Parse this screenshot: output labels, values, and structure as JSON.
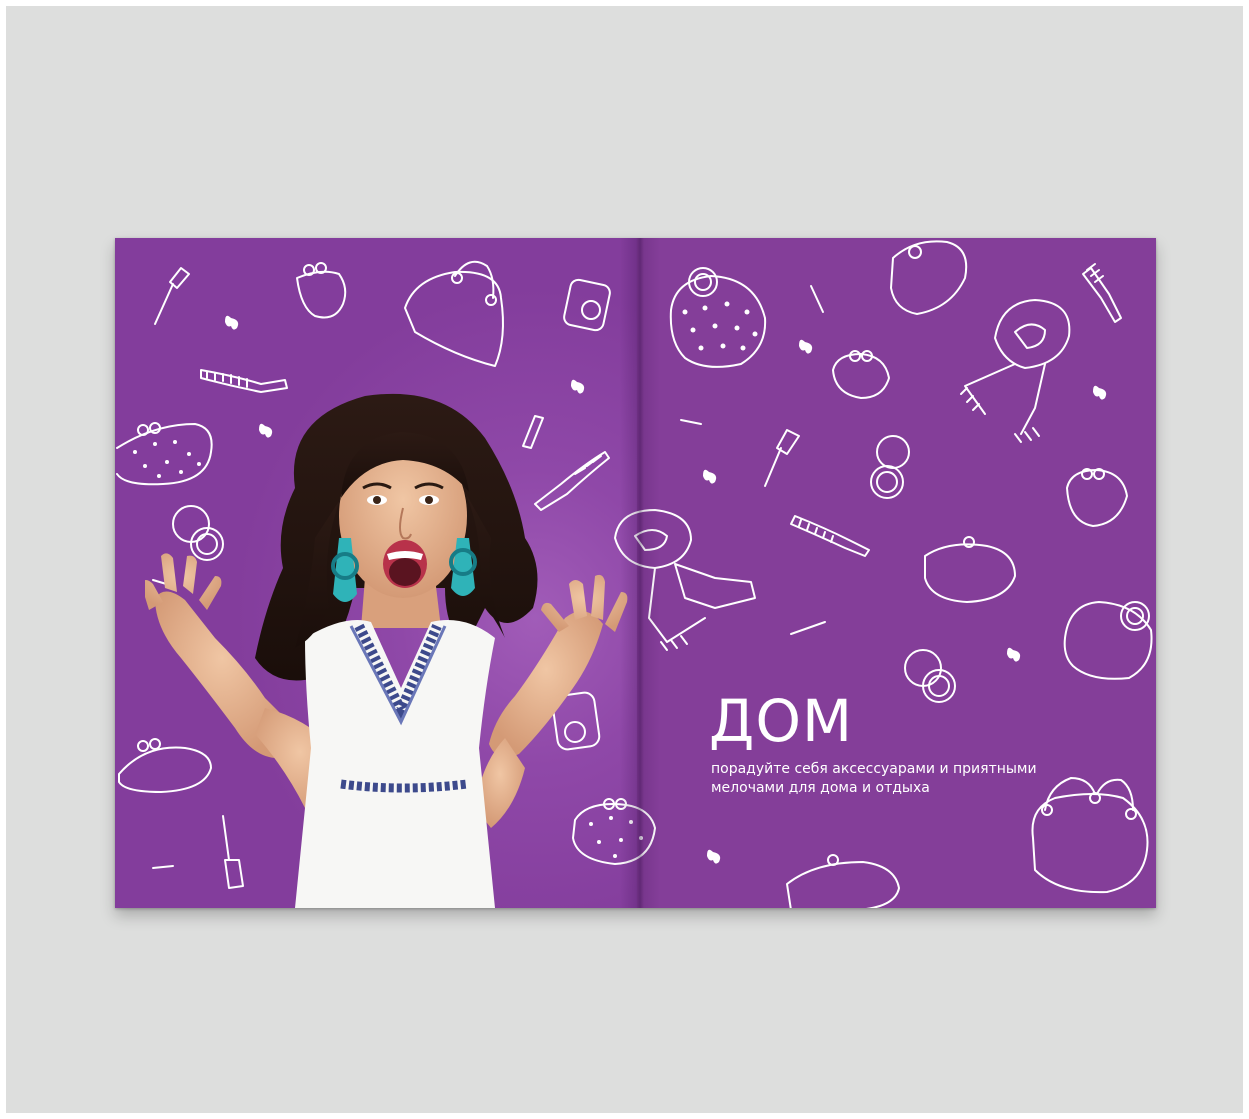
{
  "spread": {
    "right_page": {
      "title": "ДОМ",
      "subtitle_line1": "порадуйте себя аксессуарами и приятными",
      "subtitle_line2": "мелочами для дома и отдыха"
    }
  },
  "colors": {
    "background": "#dddedd",
    "page_purple": "#843e99",
    "text": "#ffffff"
  },
  "icons": [
    "makeup-brush-icon",
    "purse-icon",
    "handbag-icon",
    "compact-mirror-icon",
    "comb-icon",
    "butterfly-icon",
    "lipstick-icon",
    "scarf-icon",
    "clutch-icon"
  ]
}
